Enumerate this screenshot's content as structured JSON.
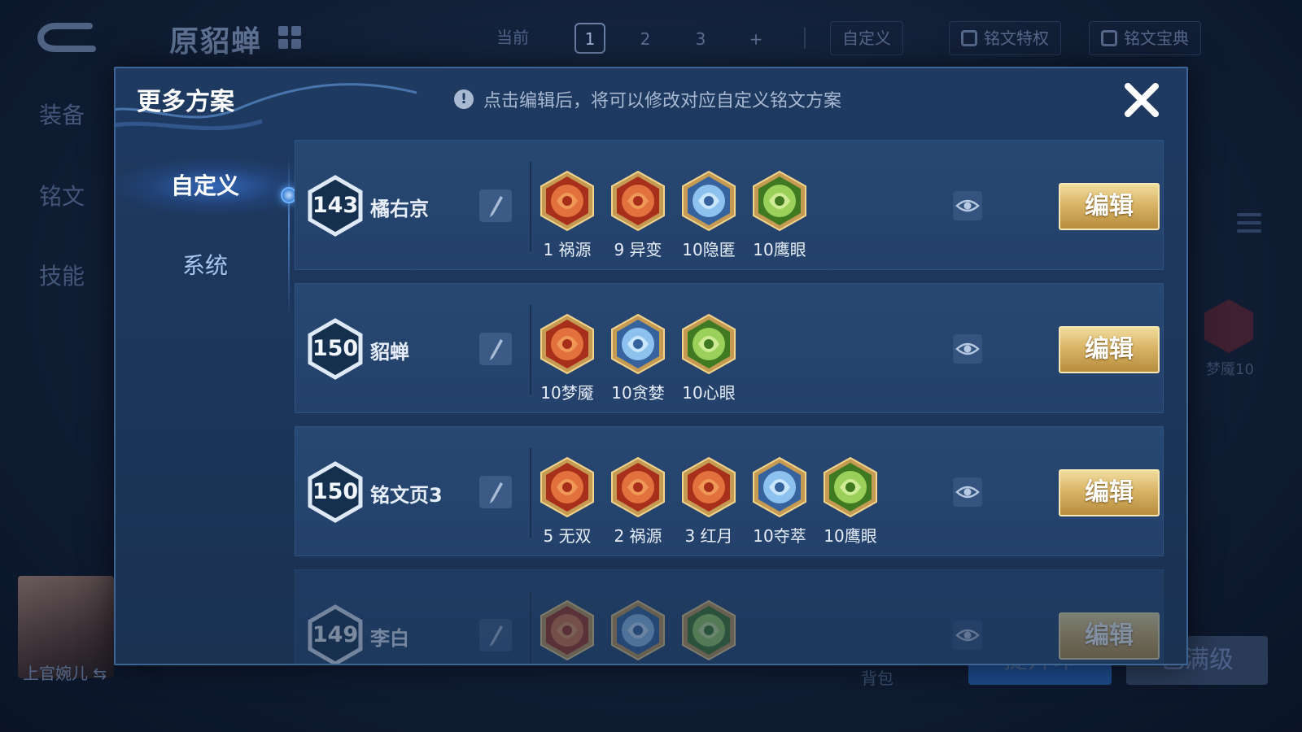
{
  "background": {
    "hero_name": "原貂蝉",
    "page_label": "当前",
    "pages": [
      "1",
      "2",
      "3",
      "+"
    ],
    "custom_label": "自定义",
    "privilege_label": "铭文特权",
    "codex_label": "铭文宝典",
    "side_tabs": [
      "装备",
      "铭文",
      "技能"
    ],
    "avatar_name": "上官婉儿 ⇆",
    "bag_label": "背包",
    "bottom_buttons": [
      "提升印",
      "已满级"
    ],
    "side_rune_label": "梦魇10"
  },
  "modal": {
    "title": "更多方案",
    "hint": "点击编辑后，将可以修改对应自定义铭文方案",
    "hint_icon": "!",
    "sidebar": [
      "自定义",
      "系统"
    ],
    "edit_label": "编辑",
    "plans": [
      {
        "level": "143",
        "name": "橘右京",
        "runes": [
          {
            "label": "1 祸源",
            "color": "red",
            "icon": "huoyuan-rune-icon"
          },
          {
            "label": "9 异变",
            "color": "red",
            "icon": "yibian-rune-icon"
          },
          {
            "label": "10隐匿",
            "color": "blue",
            "icon": "yinni-rune-icon"
          },
          {
            "label": "10鹰眼",
            "color": "green",
            "icon": "yingyan-rune-icon"
          }
        ]
      },
      {
        "level": "150",
        "name": "貂蝉",
        "runes": [
          {
            "label": "10梦魇",
            "color": "red",
            "icon": "mengyan-rune-icon"
          },
          {
            "label": "10贪婪",
            "color": "blue",
            "icon": "tanlan-rune-icon"
          },
          {
            "label": "10心眼",
            "color": "green",
            "icon": "xinyan-rune-icon"
          }
        ]
      },
      {
        "level": "150",
        "name": "铭文页3",
        "runes": [
          {
            "label": "5 无双",
            "color": "red",
            "icon": "wushuang-rune-icon"
          },
          {
            "label": "2 祸源",
            "color": "red",
            "icon": "huoyuan-rune-icon"
          },
          {
            "label": "3 红月",
            "color": "red",
            "icon": "hongyue-rune-icon"
          },
          {
            "label": "10夺萃",
            "color": "blue",
            "icon": "duocui-rune-icon"
          },
          {
            "label": "10鹰眼",
            "color": "green",
            "icon": "yingyan-rune-icon"
          }
        ]
      },
      {
        "level": "149",
        "name": "李白",
        "runes": [
          {
            "label": "",
            "color": "red",
            "icon": "red-rune-icon"
          },
          {
            "label": "",
            "color": "blue",
            "icon": "blue-rune-icon"
          },
          {
            "label": "",
            "color": "green",
            "icon": "green-rune-icon"
          }
        ]
      }
    ]
  },
  "colors": {
    "modal_bg": "#1f3a61",
    "row_bg": "#274873",
    "edit_gold": "#d9b567",
    "rune_red": "#d2542c",
    "rune_blue": "#5d8fc9",
    "rune_green": "#6fae35"
  }
}
